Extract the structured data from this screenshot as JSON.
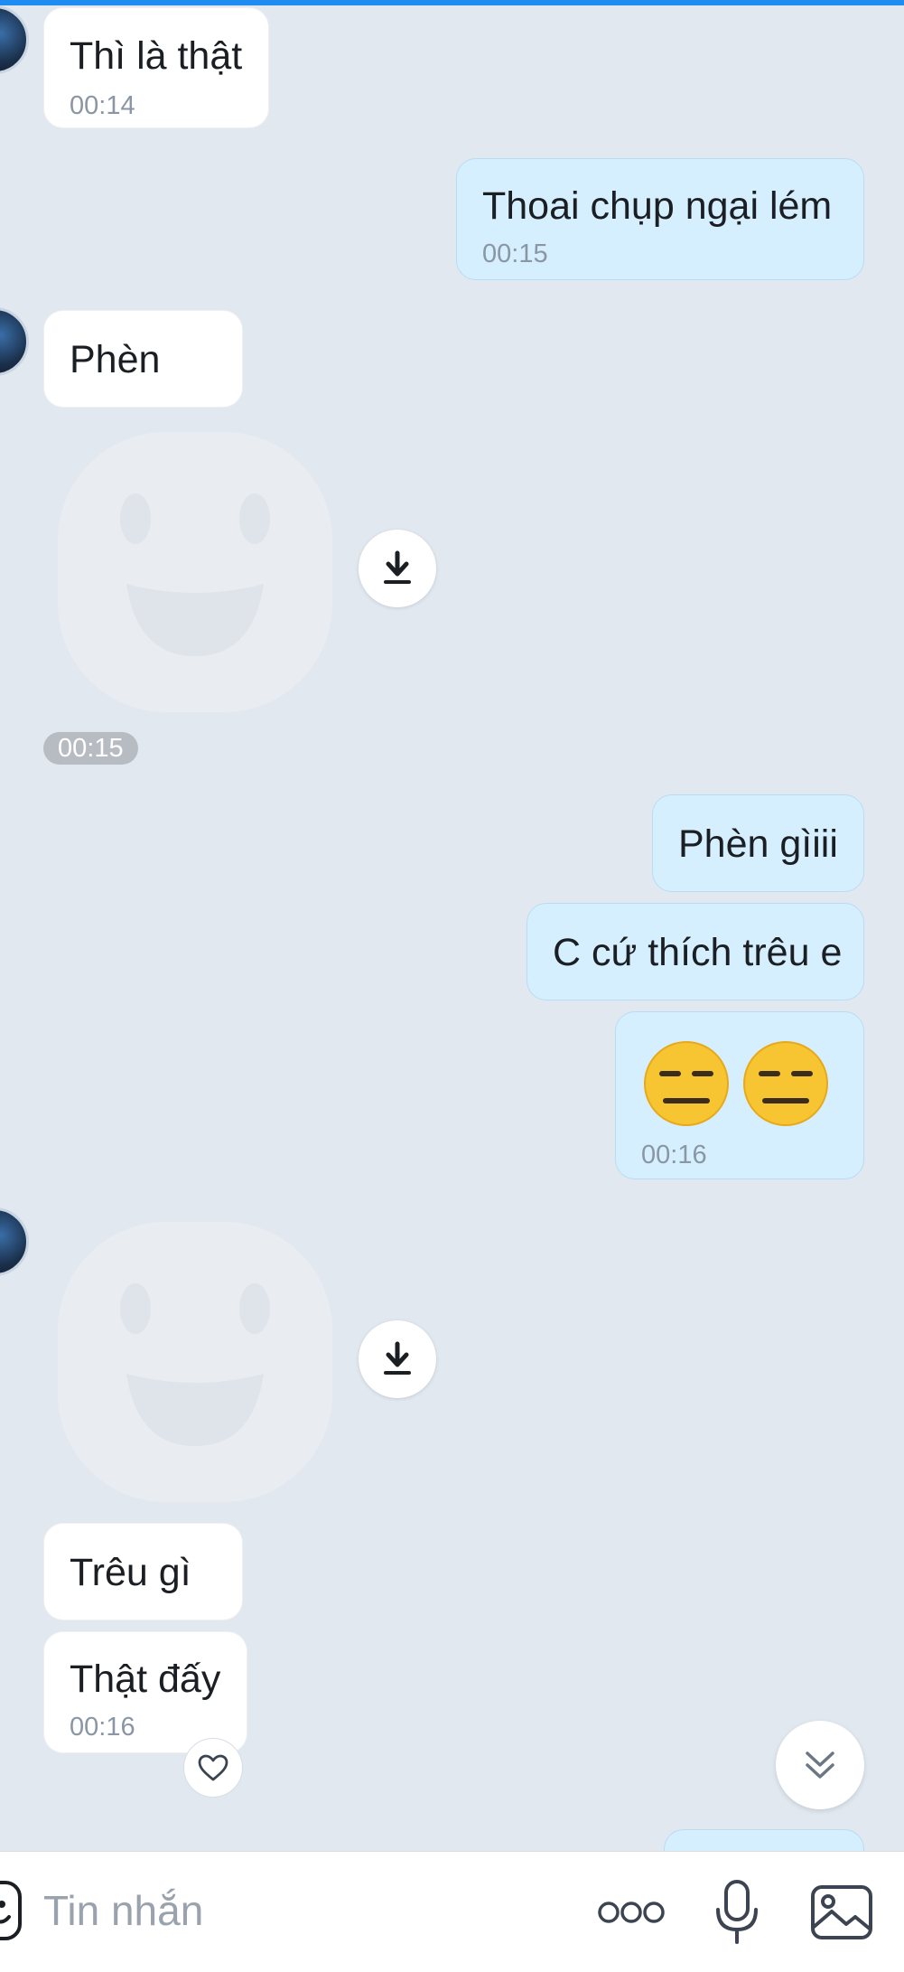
{
  "messages": [
    {
      "id": "m1",
      "direction": "incoming",
      "text": "Thì là thật",
      "time": "00:14"
    },
    {
      "id": "m2",
      "direction": "outgoing",
      "text": "Thoai chụp ngại lém",
      "time": "00:15"
    },
    {
      "id": "m3",
      "direction": "incoming",
      "text": "Phèn"
    },
    {
      "id": "m4",
      "direction": "incoming",
      "type": "sticker",
      "time": "00:15",
      "status": "not downloaded"
    },
    {
      "id": "m5",
      "direction": "outgoing",
      "text": "Phèn gìiii"
    },
    {
      "id": "m6",
      "direction": "outgoing",
      "text": "C cứ thích trêu e"
    },
    {
      "id": "m7",
      "direction": "outgoing",
      "text": "😑😑",
      "time": "00:16"
    },
    {
      "id": "m8",
      "direction": "incoming",
      "type": "sticker",
      "status": "not downloaded"
    },
    {
      "id": "m9",
      "direction": "incoming",
      "text": "Trêu gì"
    },
    {
      "id": "m10",
      "direction": "incoming",
      "text": "Thật đấy",
      "time": "00:16"
    }
  ],
  "composer": {
    "placeholder": "Tin nhắn",
    "icons": [
      "sticker-icon",
      "more-icon",
      "microphone-icon",
      "image-icon"
    ]
  },
  "colors": {
    "background": "#e2e8f0",
    "incoming_bubble": "#ffffff",
    "outgoing_bubble": "#d5efff",
    "accent": "#1e8cf0"
  }
}
